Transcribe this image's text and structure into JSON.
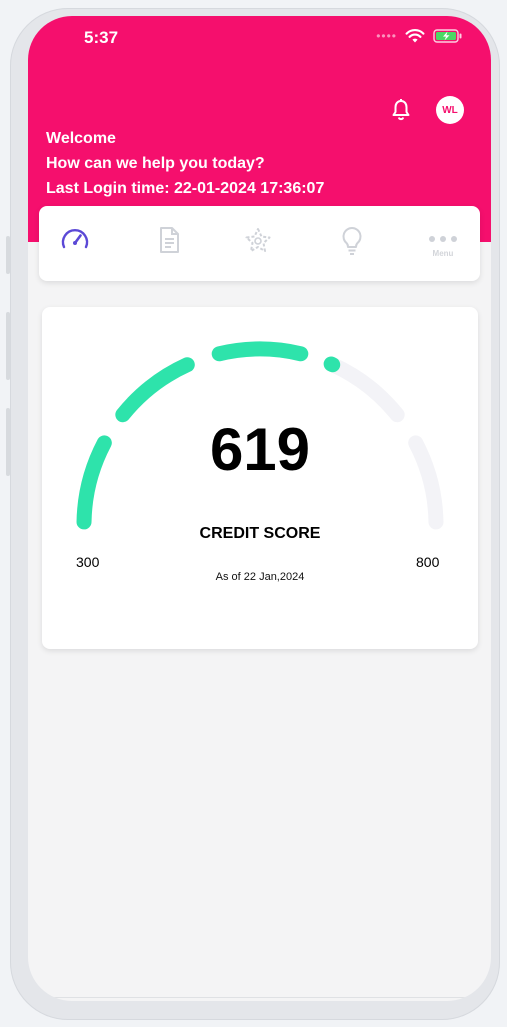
{
  "status_bar": {
    "time": "5:37"
  },
  "header": {
    "avatar_initials": "WL",
    "welcome": "Welcome",
    "help_text": "How can we help you today?",
    "last_login": "Last Login time: 22-01-2024 17:36:07"
  },
  "nav": {
    "items": [
      {
        "icon": "speedometer-icon",
        "active": true
      },
      {
        "icon": "document-icon",
        "active": false
      },
      {
        "icon": "badge-star-icon",
        "active": false
      },
      {
        "icon": "lightbulb-icon",
        "active": false
      },
      {
        "icon": "menu-dots-icon",
        "label": "Menu",
        "active": false
      }
    ],
    "active_color": "#5b49d6",
    "inactive_color": "#cfd2d8"
  },
  "credit_score": {
    "value": "619",
    "label": "CREDIT SCORE",
    "as_of": "As of 22 Jan,2024",
    "min": "300",
    "max": "800",
    "score_number": 619,
    "min_number": 300,
    "max_number": 800,
    "fill_color": "#2ee3ab",
    "track_color": "#f3f3f7"
  },
  "colors": {
    "brand": "#f50f6d",
    "background": "#f4f4f5"
  }
}
